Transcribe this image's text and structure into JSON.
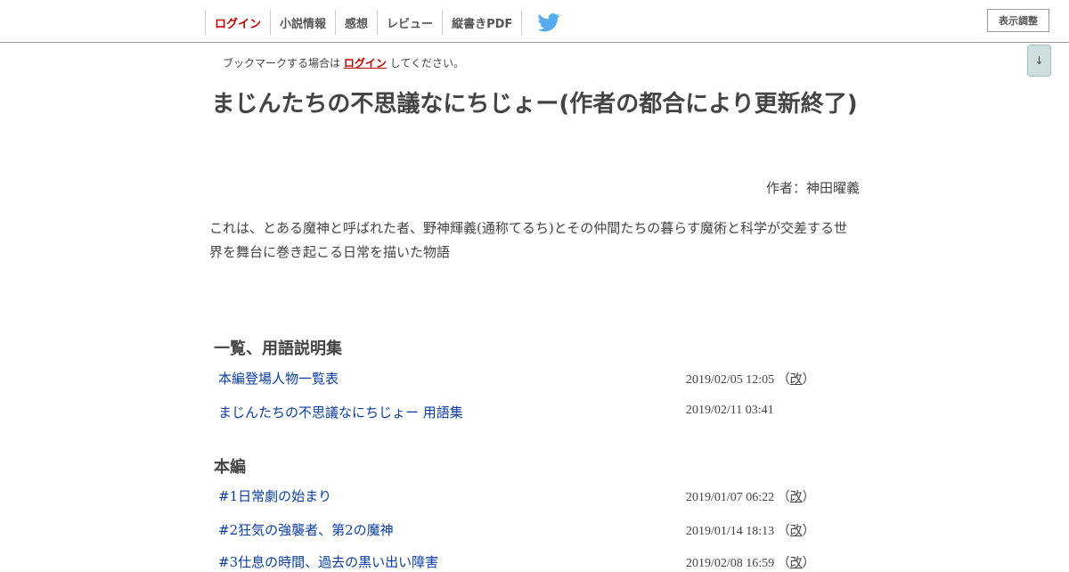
{
  "header": {
    "nav": {
      "login": "ログイン",
      "novel_info": "小説情報",
      "impressions": "感想",
      "review": "レビュー",
      "vertical_pdf": "縦書きPDF"
    },
    "display_settings": "表示調整",
    "scroll_arrow": "↓"
  },
  "bookmark": {
    "prefix": "ブックマークする場合は",
    "login_link": "ログイン",
    "suffix": "してください。"
  },
  "novel": {
    "title": "まじんたちの不思議なにちじょー(作者の都合により更新終了)",
    "author": "作者：神田曜義",
    "summary": "これは、とある魔神と呼ばれた者、野神輝義(通称てるち)とその仲間たちの暮らす魔術と科学が交差する世界を舞台に巻き起こる日常を描いた物語"
  },
  "chapters": [
    {
      "title": "一覧、用語説明集",
      "episodes": [
        {
          "title": "本編登場人物一覧表",
          "date": "2019/02/05 12:05",
          "revised": true
        },
        {
          "title": "まじんたちの不思議なにちじょー 用語集",
          "date": "2019/02/11 03:41",
          "revised": false
        }
      ]
    },
    {
      "title": "本編",
      "episodes": [
        {
          "title": "#1日常劇の始まり",
          "date": "2019/01/07 06:22",
          "revised": true
        },
        {
          "title": "#2狂気の強襲者、第2の魔神",
          "date": "2019/01/14 18:13",
          "revised": true
        },
        {
          "title": "#3仕息の時間、過去の黒い出い障害",
          "date": "2019/02/08 16:59",
          "revised": true
        }
      ]
    }
  ],
  "revision": {
    "open": "（",
    "label": "改",
    "close": "）"
  },
  "colors": {
    "login_red": "#c00000",
    "link_blue": "#0b3ea3",
    "twitter_blue": "#55acee",
    "scroll_button_bg": "#cfdfe0"
  },
  "icons": {
    "twitter": "twitter-bird-icon"
  }
}
